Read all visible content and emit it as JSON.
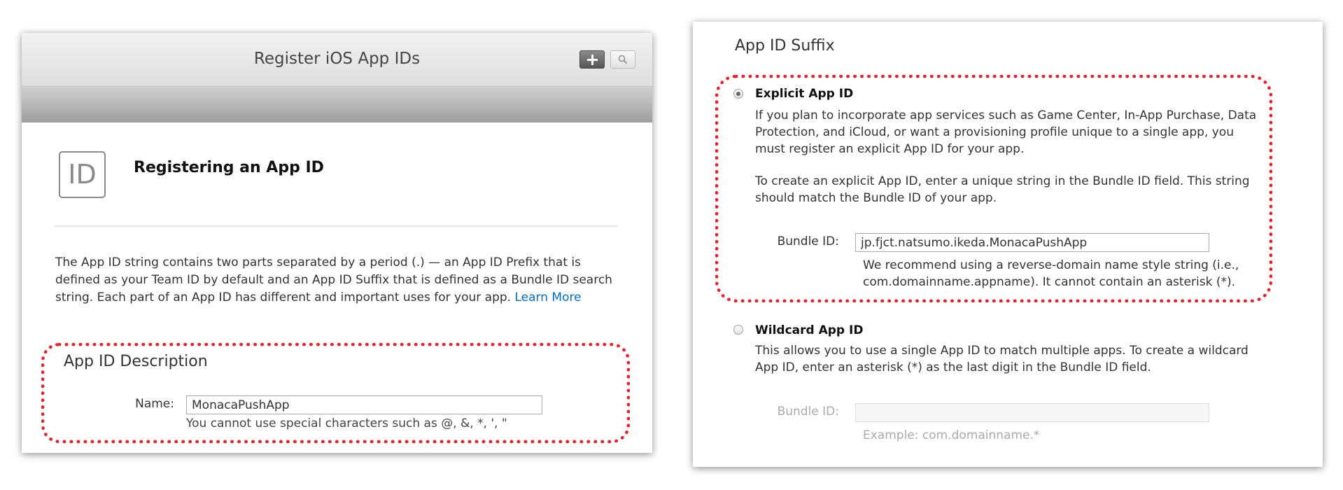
{
  "left_panel": {
    "header_title": "Register iOS App IDs",
    "add_icon": "plus-icon",
    "search_icon": "search-icon",
    "id_icon_text": "ID",
    "section_title": "Registering an App ID",
    "description": "The App ID string contains two parts separated by a period (.) — an App ID Prefix that is defined as your Team ID by default and an App ID Suffix that is defined as a Bundle ID search string. Each part of an App ID has different and important uses for your app.",
    "learn_more": "Learn More",
    "app_id_description": {
      "heading": "App ID Description",
      "name_label": "Name:",
      "name_value": "MonacaPushApp",
      "name_hint": "You cannot use special characters such as @, &, *, ', \""
    }
  },
  "right_panel": {
    "heading": "App ID Suffix",
    "explicit": {
      "selected": true,
      "title": "Explicit App ID",
      "para1": "If you plan to incorporate app services such as Game Center, In-App Purchase, Data Protection, and iCloud, or want a provisioning profile unique to a single app, you must register an explicit App ID for your app.",
      "para2": "To create an explicit App ID, enter a unique string in the Bundle ID field. This string should match the Bundle ID of your app.",
      "bundle_label": "Bundle ID:",
      "bundle_value": "jp.fjct.natsumo.ikeda.MonacaPushApp",
      "hint": "We recommend using a reverse-domain name style string (i.e., com.domainname.appname). It cannot contain an asterisk (*)."
    },
    "wildcard": {
      "selected": false,
      "title": "Wildcard App ID",
      "para": "This allows you to use a single App ID to match multiple apps. To create a wildcard App ID, enter an asterisk (*) as the last digit in the Bundle ID field.",
      "bundle_label": "Bundle ID:",
      "bundle_value": "",
      "example": "Example: com.domainname.*"
    }
  },
  "colors": {
    "highlight_dotted": "#e8222a",
    "link": "#0070c9"
  }
}
